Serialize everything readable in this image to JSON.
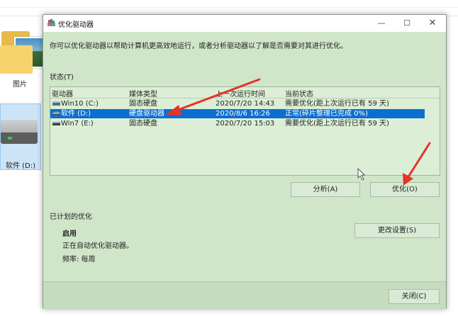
{
  "explorer": {
    "folder_label": "图片",
    "drive_label": "软件 (D:)"
  },
  "dialog": {
    "title": "优化驱动器",
    "description": "你可以优化驱动器以帮助计算机更高效地运行，或者分析驱动器以了解是否需要对其进行优化。",
    "status_label": "状态(T)",
    "columns": [
      "驱动器",
      "媒体类型",
      "上一次运行时间",
      "当前状态"
    ],
    "drives": [
      {
        "name": "Win10 (C:)",
        "media": "固态硬盘",
        "last_run": "2020/7/20 14:43",
        "status": "需要优化(距上次运行已有 59 天)",
        "selected": false
      },
      {
        "name": "软件 (D:)",
        "media": "硬盘驱动器",
        "last_run": "2020/8/6 16:26",
        "status": "正常(碎片整理已完成 0%)",
        "selected": true
      },
      {
        "name": "Win7 (E:)",
        "media": "固态硬盘",
        "last_run": "2020/7/20 15:03",
        "status": "需要优化(距上次运行已有 59 天)",
        "selected": false
      }
    ],
    "analyze_button": "分析(A)",
    "optimize_button": "优化(O)",
    "scheduled_label": "已计划的优化",
    "schedule_enabled": "启用",
    "schedule_status": "正在自动优化驱动器。",
    "schedule_frequency": "频率: 每周",
    "change_settings_button": "更改设置(S)",
    "close_button": "关闭(C)",
    "window_controls": {
      "minimize": "—",
      "maximize": "☐",
      "close": "✕"
    }
  },
  "colors": {
    "dialog_bg": "#cfe6c8",
    "selection": "#0a6fd0",
    "annotation_arrow": "#e8332a"
  },
  "icons": [
    "optimize-drives-app-icon",
    "drive-icon",
    "folder-icon",
    "hard-drive-icon",
    "arrow-annotation"
  ]
}
